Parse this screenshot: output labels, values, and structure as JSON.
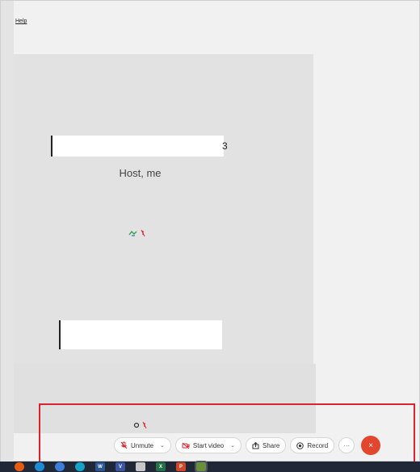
{
  "menu": {
    "help_label": "Help"
  },
  "video": {
    "participant_label": "Host, me",
    "redaction_mark": "3"
  },
  "controls": {
    "unmute_label": "Unmute",
    "start_video_label": "Start video",
    "share_label": "Share",
    "record_label": "Record",
    "more_label": "···",
    "end_label": "×",
    "chevron": "⌄"
  },
  "colors": {
    "end_call": "#e3462f",
    "mute_red": "#d9232e",
    "highlight_border": "#d9232e"
  },
  "taskbar": {
    "icons": [
      {
        "name": "firefox-icon",
        "color": "#e55b13",
        "glyph": ""
      },
      {
        "name": "edge-icon",
        "color": "#1e8bd6",
        "glyph": ""
      },
      {
        "name": "browser-icon",
        "color": "#3b7dd8",
        "glyph": ""
      },
      {
        "name": "webex-icon",
        "color": "#14a2c9",
        "glyph": ""
      },
      {
        "name": "word-icon",
        "color": "#2b5797",
        "glyph": "W"
      },
      {
        "name": "visio-icon",
        "color": "#3955a3",
        "glyph": "V"
      },
      {
        "name": "eraser-icon",
        "color": "#c7c7c7",
        "glyph": ""
      },
      {
        "name": "excel-icon",
        "color": "#217346",
        "glyph": "X"
      },
      {
        "name": "powerpoint-icon",
        "color": "#d24726",
        "glyph": "P"
      },
      {
        "name": "app-icon",
        "color": "#6a8f3a",
        "glyph": ""
      }
    ]
  }
}
